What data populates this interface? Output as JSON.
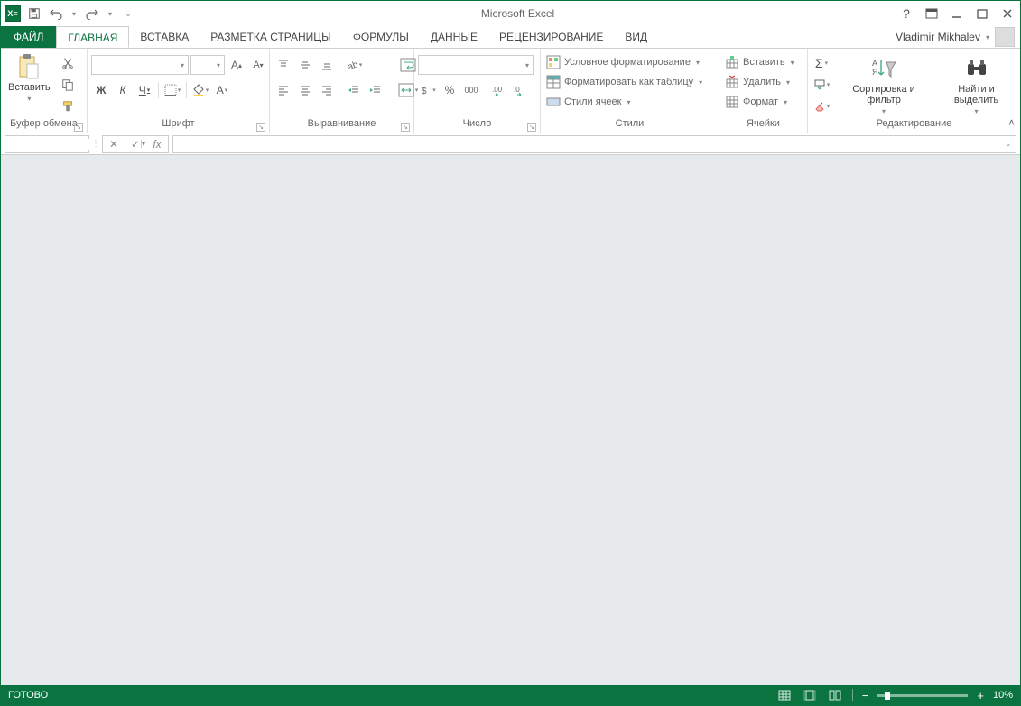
{
  "titlebar": {
    "app_title": "Microsoft Excel"
  },
  "tabs": {
    "file": "ФАЙЛ",
    "items": [
      "ГЛАВНАЯ",
      "ВСТАВКА",
      "РАЗМЕТКА СТРАНИЦЫ",
      "ФОРМУЛЫ",
      "ДАННЫЕ",
      "РЕЦЕНЗИРОВАНИЕ",
      "ВИД"
    ],
    "active_index": 0
  },
  "user": {
    "name": "Vladimir Mikhalev"
  },
  "ribbon": {
    "clipboard": {
      "paste": "Вставить",
      "label": "Буфер обмена"
    },
    "font": {
      "label": "Шрифт",
      "bold": "Ж",
      "italic": "К",
      "underline": "Ч"
    },
    "alignment": {
      "label": "Выравнивание"
    },
    "number": {
      "label": "Число",
      "percent": "%",
      "thousand": "000"
    },
    "styles": {
      "label": "Стили",
      "conditional": "Условное форматирование",
      "table": "Форматировать как таблицу",
      "cell_styles": "Стили ячеек"
    },
    "cells": {
      "label": "Ячейки",
      "insert": "Вставить",
      "delete": "Удалить",
      "format": "Формат"
    },
    "editing": {
      "label": "Редактирование",
      "sort": "Сортировка и фильтр",
      "find": "Найти и выделить"
    }
  },
  "statusbar": {
    "ready": "ГОТОВО",
    "zoom": "10%"
  }
}
